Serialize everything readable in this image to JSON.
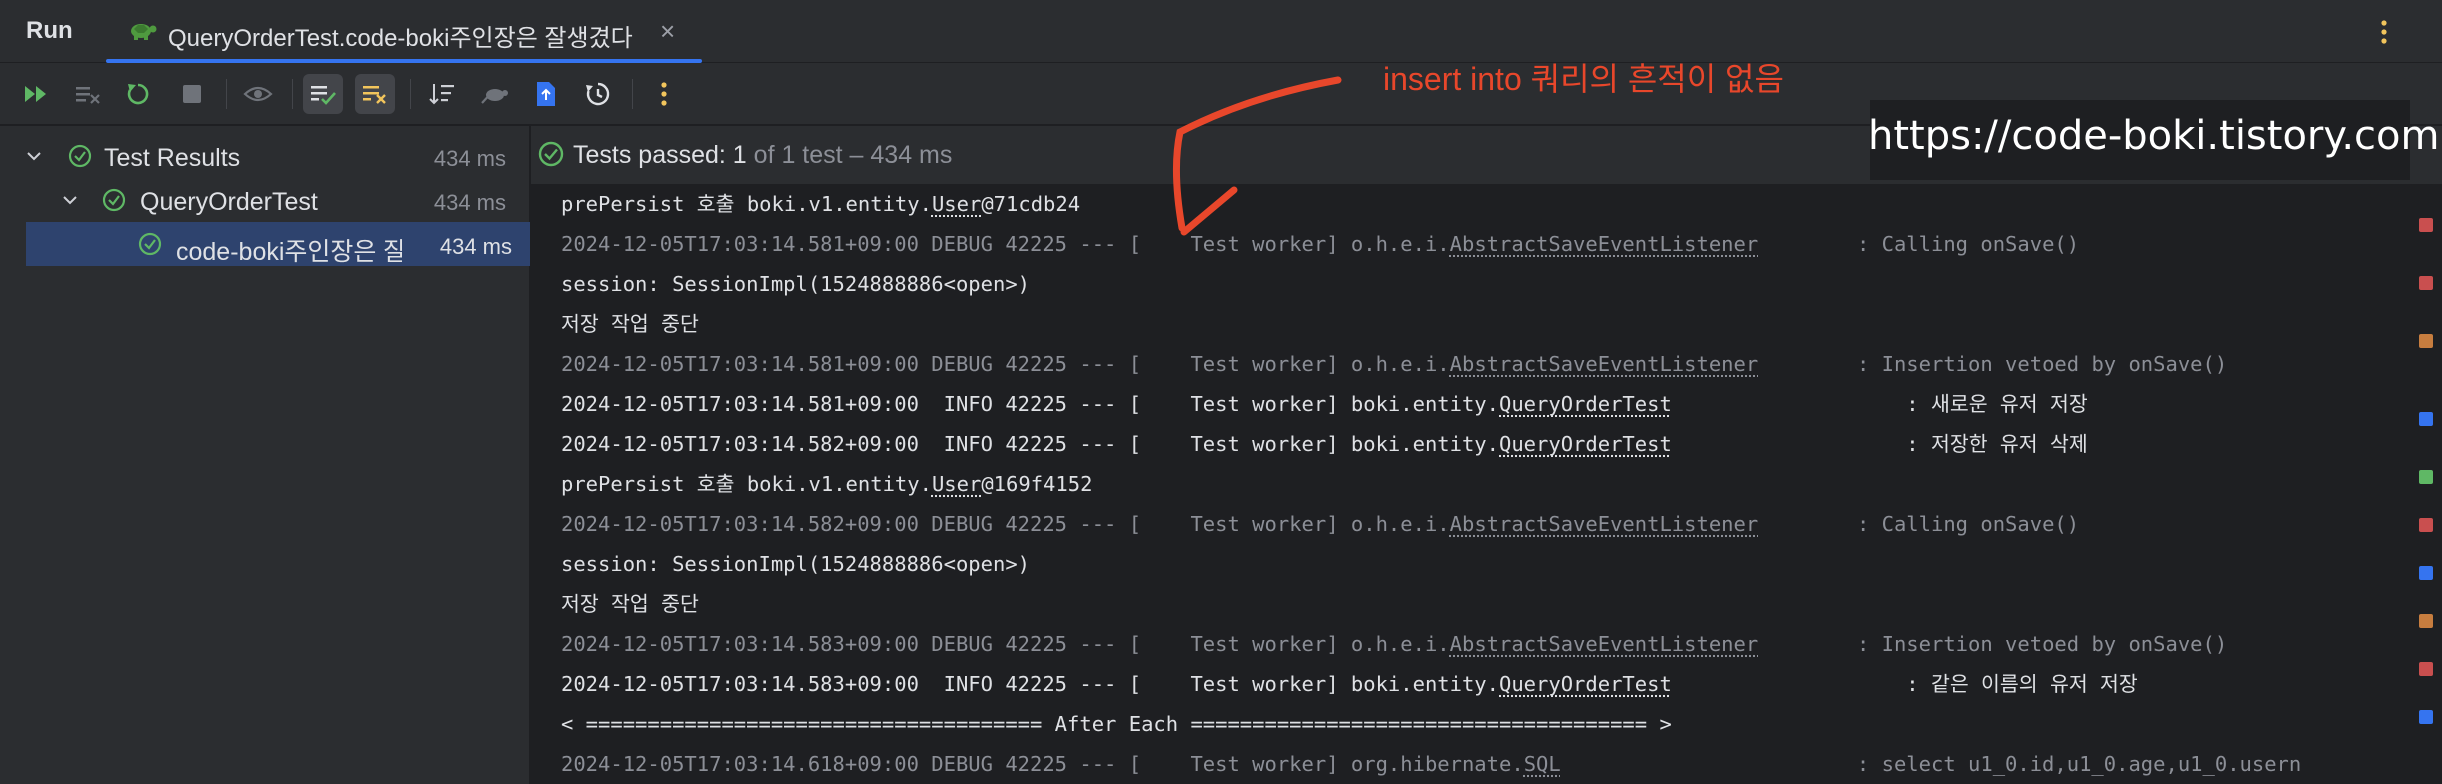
{
  "window": {
    "run_title": "Run",
    "tab_label": "QueryOrderTest.code-boki주인장은 잘생겼다",
    "tab_close": "×"
  },
  "tree": [
    {
      "label": "Test Results",
      "time": "434 ms"
    },
    {
      "label": "QueryOrderTest",
      "time": "434 ms"
    },
    {
      "label": "code-boki주인장은 잘",
      "time": "434 ms"
    }
  ],
  "status": {
    "passed_label": "Tests passed: 1",
    "passed_detail": " of 1 test – 434 ms"
  },
  "console_lines": [
    {
      "parts": [
        {
          "t": "prePersist 호출 boki.v1.entity."
        },
        {
          "t": "User",
          "u": true
        },
        {
          "t": "@71cdb24"
        }
      ],
      "style": "bright"
    },
    {
      "parts": [
        {
          "t": "2024-12-05T17:03:14.581+09:00 DEBUG 42225 --- [    Test worker] o.h.e.i."
        },
        {
          "t": "AbstractSaveEventListener",
          "u": true
        },
        {
          "t": "        : Calling onSave()"
        }
      ],
      "style": "dim"
    },
    {
      "parts": [
        {
          "t": "session: SessionImpl(1524888886<open>)"
        }
      ],
      "style": "bright"
    },
    {
      "parts": [
        {
          "t": "저장 작업 중단"
        }
      ],
      "style": "bright"
    },
    {
      "parts": [
        {
          "t": "2024-12-05T17:03:14.581+09:00 DEBUG 42225 --- [    Test worker] o.h.e.i."
        },
        {
          "t": "AbstractSaveEventListener",
          "u": true
        },
        {
          "t": "        : Insertion vetoed by onSave()"
        }
      ],
      "style": "dim"
    },
    {
      "parts": [
        {
          "t": "2024-12-05T17:03:14.581+09:00  INFO 42225 --- [    Test worker] boki.entity."
        },
        {
          "t": "QueryOrderTest",
          "u": true
        },
        {
          "t": "                   : 새로운 유저 저장"
        }
      ],
      "style": "bright"
    },
    {
      "parts": [
        {
          "t": "2024-12-05T17:03:14.582+09:00  INFO 42225 --- [    Test worker] boki.entity."
        },
        {
          "t": "QueryOrderTest",
          "u": true
        },
        {
          "t": "                   : 저장한 유저 삭제"
        }
      ],
      "style": "bright"
    },
    {
      "parts": [
        {
          "t": "prePersist 호출 boki.v1.entity."
        },
        {
          "t": "User",
          "u": true
        },
        {
          "t": "@169f4152"
        }
      ],
      "style": "bright"
    },
    {
      "parts": [
        {
          "t": "2024-12-05T17:03:14.582+09:00 DEBUG 42225 --- [    Test worker] o.h.e.i."
        },
        {
          "t": "AbstractSaveEventListener",
          "u": true
        },
        {
          "t": "        : Calling onSave()"
        }
      ],
      "style": "dim"
    },
    {
      "parts": [
        {
          "t": "session: SessionImpl(1524888886<open>)"
        }
      ],
      "style": "bright"
    },
    {
      "parts": [
        {
          "t": "저장 작업 중단"
        }
      ],
      "style": "bright"
    },
    {
      "parts": [
        {
          "t": "2024-12-05T17:03:14.583+09:00 DEBUG 42225 --- [    Test worker] o.h.e.i."
        },
        {
          "t": "AbstractSaveEventListener",
          "u": true
        },
        {
          "t": "        : Insertion vetoed by onSave()"
        }
      ],
      "style": "dim"
    },
    {
      "parts": [
        {
          "t": "2024-12-05T17:03:14.583+09:00  INFO 42225 --- [    Test worker] boki.entity."
        },
        {
          "t": "QueryOrderTest",
          "u": true
        },
        {
          "t": "                   : 같은 이름의 유저 저장"
        }
      ],
      "style": "bright"
    },
    {
      "parts": [
        {
          "t": "< ===================================== After Each ===================================== >"
        }
      ],
      "style": "bright"
    },
    {
      "parts": [
        {
          "t": "2024-12-05T17:03:14.618+09:00 DEBUG 42225 --- [    Test worker] org.hibernate."
        },
        {
          "t": "SQL",
          "u": true
        },
        {
          "t": "                        : select u1_0.id,u1_0.age,u1_0.usern"
        }
      ],
      "style": "dim"
    }
  ],
  "annotation": "insert into 쿼리의 흔적이 없음",
  "watermark": "https://code-boki.tistory.com",
  "colors": {
    "accent": "#3574f0",
    "success": "#5fb865",
    "annotation": "#e8472b",
    "run_green": "#5fb865",
    "warning_yellow": "#f2c55c"
  },
  "icons": {
    "tab": "turtle-icon",
    "toolbar": [
      "rerun-all-icon",
      "rerun-failed-icon",
      "rerun-icon",
      "stop-icon",
      "show-passed-icon",
      "show-passed-toggle-icon",
      "show-ignored-toggle-icon",
      "sort-icon",
      "import-tests-icon",
      "export-icon",
      "history-icon",
      "more-vertical-icon"
    ]
  }
}
